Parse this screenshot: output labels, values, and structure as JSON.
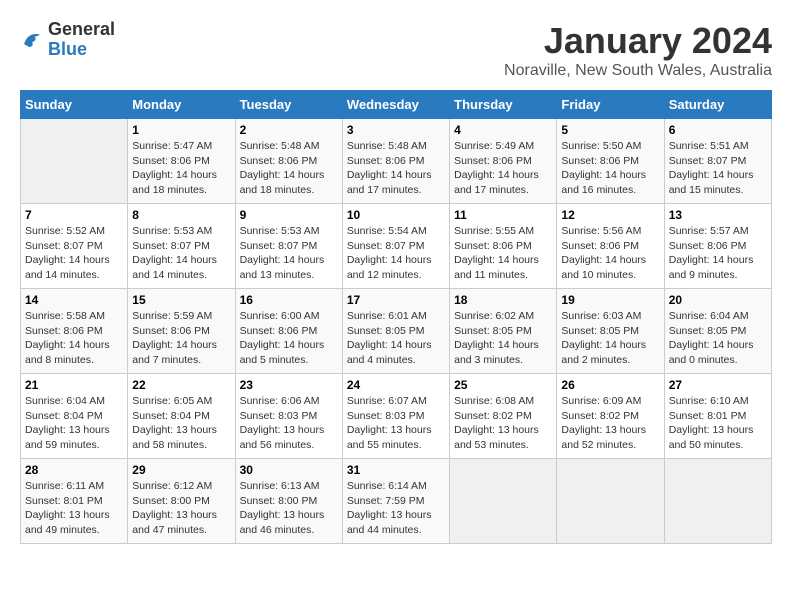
{
  "logo": {
    "general": "General",
    "blue": "Blue"
  },
  "title": "January 2024",
  "location": "Noraville, New South Wales, Australia",
  "days_header": [
    "Sunday",
    "Monday",
    "Tuesday",
    "Wednesday",
    "Thursday",
    "Friday",
    "Saturday"
  ],
  "weeks": [
    [
      {
        "day": "",
        "info": ""
      },
      {
        "day": "1",
        "info": "Sunrise: 5:47 AM\nSunset: 8:06 PM\nDaylight: 14 hours\nand 18 minutes."
      },
      {
        "day": "2",
        "info": "Sunrise: 5:48 AM\nSunset: 8:06 PM\nDaylight: 14 hours\nand 18 minutes."
      },
      {
        "day": "3",
        "info": "Sunrise: 5:48 AM\nSunset: 8:06 PM\nDaylight: 14 hours\nand 17 minutes."
      },
      {
        "day": "4",
        "info": "Sunrise: 5:49 AM\nSunset: 8:06 PM\nDaylight: 14 hours\nand 17 minutes."
      },
      {
        "day": "5",
        "info": "Sunrise: 5:50 AM\nSunset: 8:06 PM\nDaylight: 14 hours\nand 16 minutes."
      },
      {
        "day": "6",
        "info": "Sunrise: 5:51 AM\nSunset: 8:07 PM\nDaylight: 14 hours\nand 15 minutes."
      }
    ],
    [
      {
        "day": "7",
        "info": "Sunrise: 5:52 AM\nSunset: 8:07 PM\nDaylight: 14 hours\nand 14 minutes."
      },
      {
        "day": "8",
        "info": "Sunrise: 5:53 AM\nSunset: 8:07 PM\nDaylight: 14 hours\nand 14 minutes."
      },
      {
        "day": "9",
        "info": "Sunrise: 5:53 AM\nSunset: 8:07 PM\nDaylight: 14 hours\nand 13 minutes."
      },
      {
        "day": "10",
        "info": "Sunrise: 5:54 AM\nSunset: 8:07 PM\nDaylight: 14 hours\nand 12 minutes."
      },
      {
        "day": "11",
        "info": "Sunrise: 5:55 AM\nSunset: 8:06 PM\nDaylight: 14 hours\nand 11 minutes."
      },
      {
        "day": "12",
        "info": "Sunrise: 5:56 AM\nSunset: 8:06 PM\nDaylight: 14 hours\nand 10 minutes."
      },
      {
        "day": "13",
        "info": "Sunrise: 5:57 AM\nSunset: 8:06 PM\nDaylight: 14 hours\nand 9 minutes."
      }
    ],
    [
      {
        "day": "14",
        "info": "Sunrise: 5:58 AM\nSunset: 8:06 PM\nDaylight: 14 hours\nand 8 minutes."
      },
      {
        "day": "15",
        "info": "Sunrise: 5:59 AM\nSunset: 8:06 PM\nDaylight: 14 hours\nand 7 minutes."
      },
      {
        "day": "16",
        "info": "Sunrise: 6:00 AM\nSunset: 8:06 PM\nDaylight: 14 hours\nand 5 minutes."
      },
      {
        "day": "17",
        "info": "Sunrise: 6:01 AM\nSunset: 8:05 PM\nDaylight: 14 hours\nand 4 minutes."
      },
      {
        "day": "18",
        "info": "Sunrise: 6:02 AM\nSunset: 8:05 PM\nDaylight: 14 hours\nand 3 minutes."
      },
      {
        "day": "19",
        "info": "Sunrise: 6:03 AM\nSunset: 8:05 PM\nDaylight: 14 hours\nand 2 minutes."
      },
      {
        "day": "20",
        "info": "Sunrise: 6:04 AM\nSunset: 8:05 PM\nDaylight: 14 hours\nand 0 minutes."
      }
    ],
    [
      {
        "day": "21",
        "info": "Sunrise: 6:04 AM\nSunset: 8:04 PM\nDaylight: 13 hours\nand 59 minutes."
      },
      {
        "day": "22",
        "info": "Sunrise: 6:05 AM\nSunset: 8:04 PM\nDaylight: 13 hours\nand 58 minutes."
      },
      {
        "day": "23",
        "info": "Sunrise: 6:06 AM\nSunset: 8:03 PM\nDaylight: 13 hours\nand 56 minutes."
      },
      {
        "day": "24",
        "info": "Sunrise: 6:07 AM\nSunset: 8:03 PM\nDaylight: 13 hours\nand 55 minutes."
      },
      {
        "day": "25",
        "info": "Sunrise: 6:08 AM\nSunset: 8:02 PM\nDaylight: 13 hours\nand 53 minutes."
      },
      {
        "day": "26",
        "info": "Sunrise: 6:09 AM\nSunset: 8:02 PM\nDaylight: 13 hours\nand 52 minutes."
      },
      {
        "day": "27",
        "info": "Sunrise: 6:10 AM\nSunset: 8:01 PM\nDaylight: 13 hours\nand 50 minutes."
      }
    ],
    [
      {
        "day": "28",
        "info": "Sunrise: 6:11 AM\nSunset: 8:01 PM\nDaylight: 13 hours\nand 49 minutes."
      },
      {
        "day": "29",
        "info": "Sunrise: 6:12 AM\nSunset: 8:00 PM\nDaylight: 13 hours\nand 47 minutes."
      },
      {
        "day": "30",
        "info": "Sunrise: 6:13 AM\nSunset: 8:00 PM\nDaylight: 13 hours\nand 46 minutes."
      },
      {
        "day": "31",
        "info": "Sunrise: 6:14 AM\nSunset: 7:59 PM\nDaylight: 13 hours\nand 44 minutes."
      },
      {
        "day": "",
        "info": ""
      },
      {
        "day": "",
        "info": ""
      },
      {
        "day": "",
        "info": ""
      }
    ]
  ]
}
